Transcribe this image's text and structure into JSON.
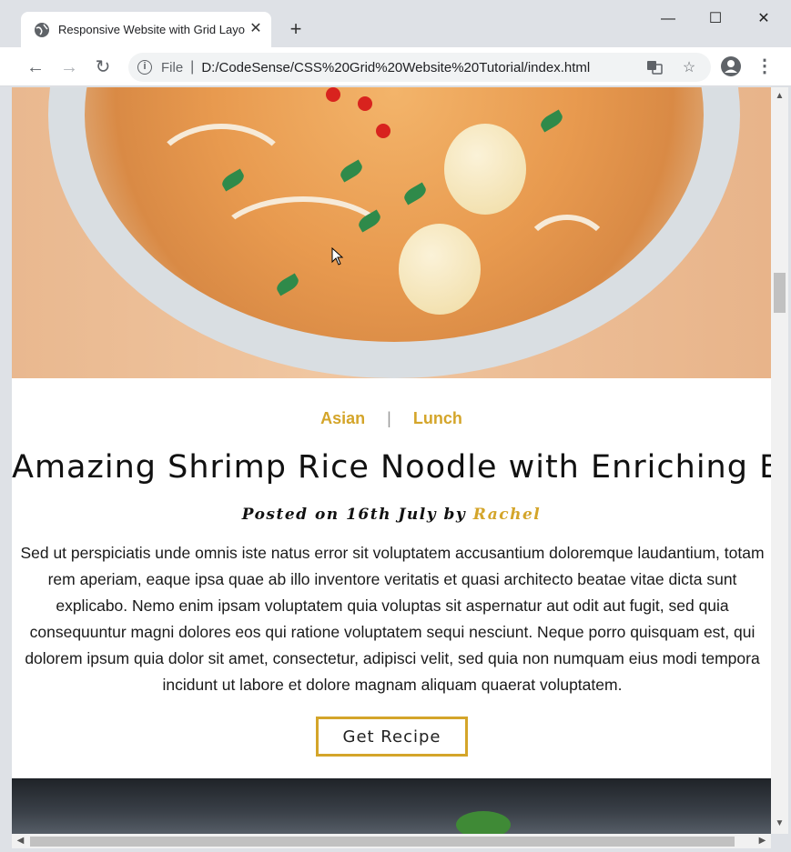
{
  "browser": {
    "tab_title": "Responsive Website with Grid Layout",
    "tab_close": "✕",
    "new_tab": "+",
    "window_controls": {
      "minimize": "—",
      "maximize": "☐",
      "close": "✕"
    },
    "nav": {
      "back": "←",
      "forward": "→",
      "reload": "↻"
    },
    "address": {
      "scheme_label": "File",
      "separator": "|",
      "url": "D:/CodeSense/CSS%20Grid%20Website%20Tutorial/index.html"
    },
    "icons": {
      "tab_favicon": "globe-icon",
      "info": "info-icon",
      "translate": "translate-icon",
      "bookmark": "star-icon",
      "profile": "account-icon",
      "menu": "kebab-menu-icon"
    }
  },
  "post": {
    "categories": [
      "Asian",
      "Lunch"
    ],
    "category_separator": "|",
    "title": "Amazing Shrimp Rice Noodle with Enriching Broth",
    "byline_prefix": "Posted on 16th July by",
    "author": "Rachel",
    "description": "Sed ut perspiciatis unde omnis iste natus error sit voluptatem accusantium doloremque laudantium, totam rem aperiam, eaque ipsa quae ab illo inventore veritatis et quasi architecto beatae vitae dicta sunt explicabo. Nemo enim ipsam voluptatem quia voluptas sit aspernatur aut odit aut fugit, sed quia consequuntur magni dolores eos qui ratione voluptatem sequi nesciunt. Neque porro quisquam est, qui dolorem ipsum quia dolor sit amet, consectetur, adipisci velit, sed quia non numquam eius modi tempora incidunt ut labore et dolore magnam aliquam quaerat voluptatem.",
    "button_label": "Get Recipe"
  },
  "colors": {
    "accent": "#d4a52a",
    "text": "#111111",
    "chrome_bg": "#dee1e6"
  }
}
